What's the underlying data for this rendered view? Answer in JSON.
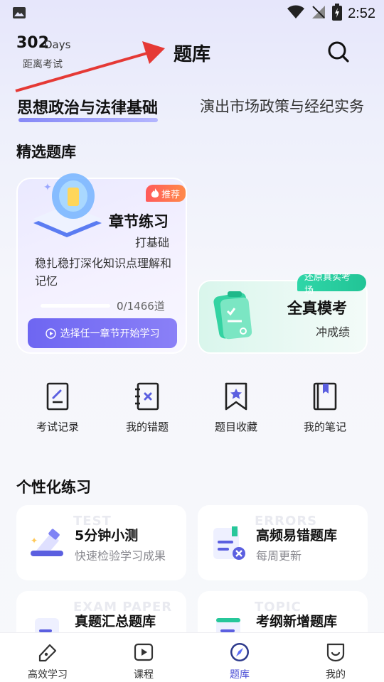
{
  "status_bar": {
    "time": "2:52"
  },
  "header": {
    "days_number": "302",
    "days_unit": "Days",
    "days_caption": "距离考试",
    "title": "题库"
  },
  "subject_tabs": [
    {
      "label": "思想政治与法律基础",
      "active": true
    },
    {
      "label": "演出市场政策与经纪实务",
      "active": false
    }
  ],
  "featured": {
    "section_title": "精选题库",
    "chapter": {
      "badge": "推荐",
      "title": "章节练习",
      "subtitle": "打基础",
      "description": "稳扎稳打深化知识点理解和记忆",
      "progress_current": "0",
      "progress_total": "/1466道",
      "progress_fraction": 0,
      "button_label": "选择任一章节开始学习"
    },
    "mock": {
      "badge": "还原真实考场",
      "title": "全真模考",
      "subtitle": "冲成绩"
    }
  },
  "quick_links": [
    {
      "label": "考试记录",
      "icon": "exam-record-icon"
    },
    {
      "label": "我的错题",
      "icon": "wrong-questions-icon"
    },
    {
      "label": "题目收藏",
      "icon": "favorites-icon"
    },
    {
      "label": "我的笔记",
      "icon": "notes-icon"
    }
  ],
  "personal": {
    "section_title": "个性化练习",
    "cards": [
      {
        "ghost": "TEST",
        "title": "5分钟小测",
        "subtitle": "快速检验学习成果",
        "icon": "quick-test-icon"
      },
      {
        "ghost": "ERRORS",
        "title": "高频易错题库",
        "subtitle": "每周更新",
        "icon": "frequent-errors-icon"
      },
      {
        "ghost": "EXAM PAPER",
        "title": "真题汇总题库",
        "subtitle": "",
        "icon": "past-papers-icon"
      },
      {
        "ghost": "TOPIC",
        "title": "考纲新增题库",
        "subtitle": "",
        "icon": "new-topics-icon"
      }
    ]
  },
  "tab_bar": [
    {
      "label": "高效学习",
      "icon": "study-icon",
      "active": false
    },
    {
      "label": "课程",
      "icon": "course-play-icon",
      "active": false
    },
    {
      "label": "题库",
      "icon": "compass-icon",
      "active": true
    },
    {
      "label": "我的",
      "icon": "profile-icon",
      "active": false
    }
  ],
  "colors": {
    "accent": "#6b6ef5",
    "badge_red": "#ff5a5a",
    "badge_green": "#22c496",
    "active_tab": "#4b4fd6"
  }
}
